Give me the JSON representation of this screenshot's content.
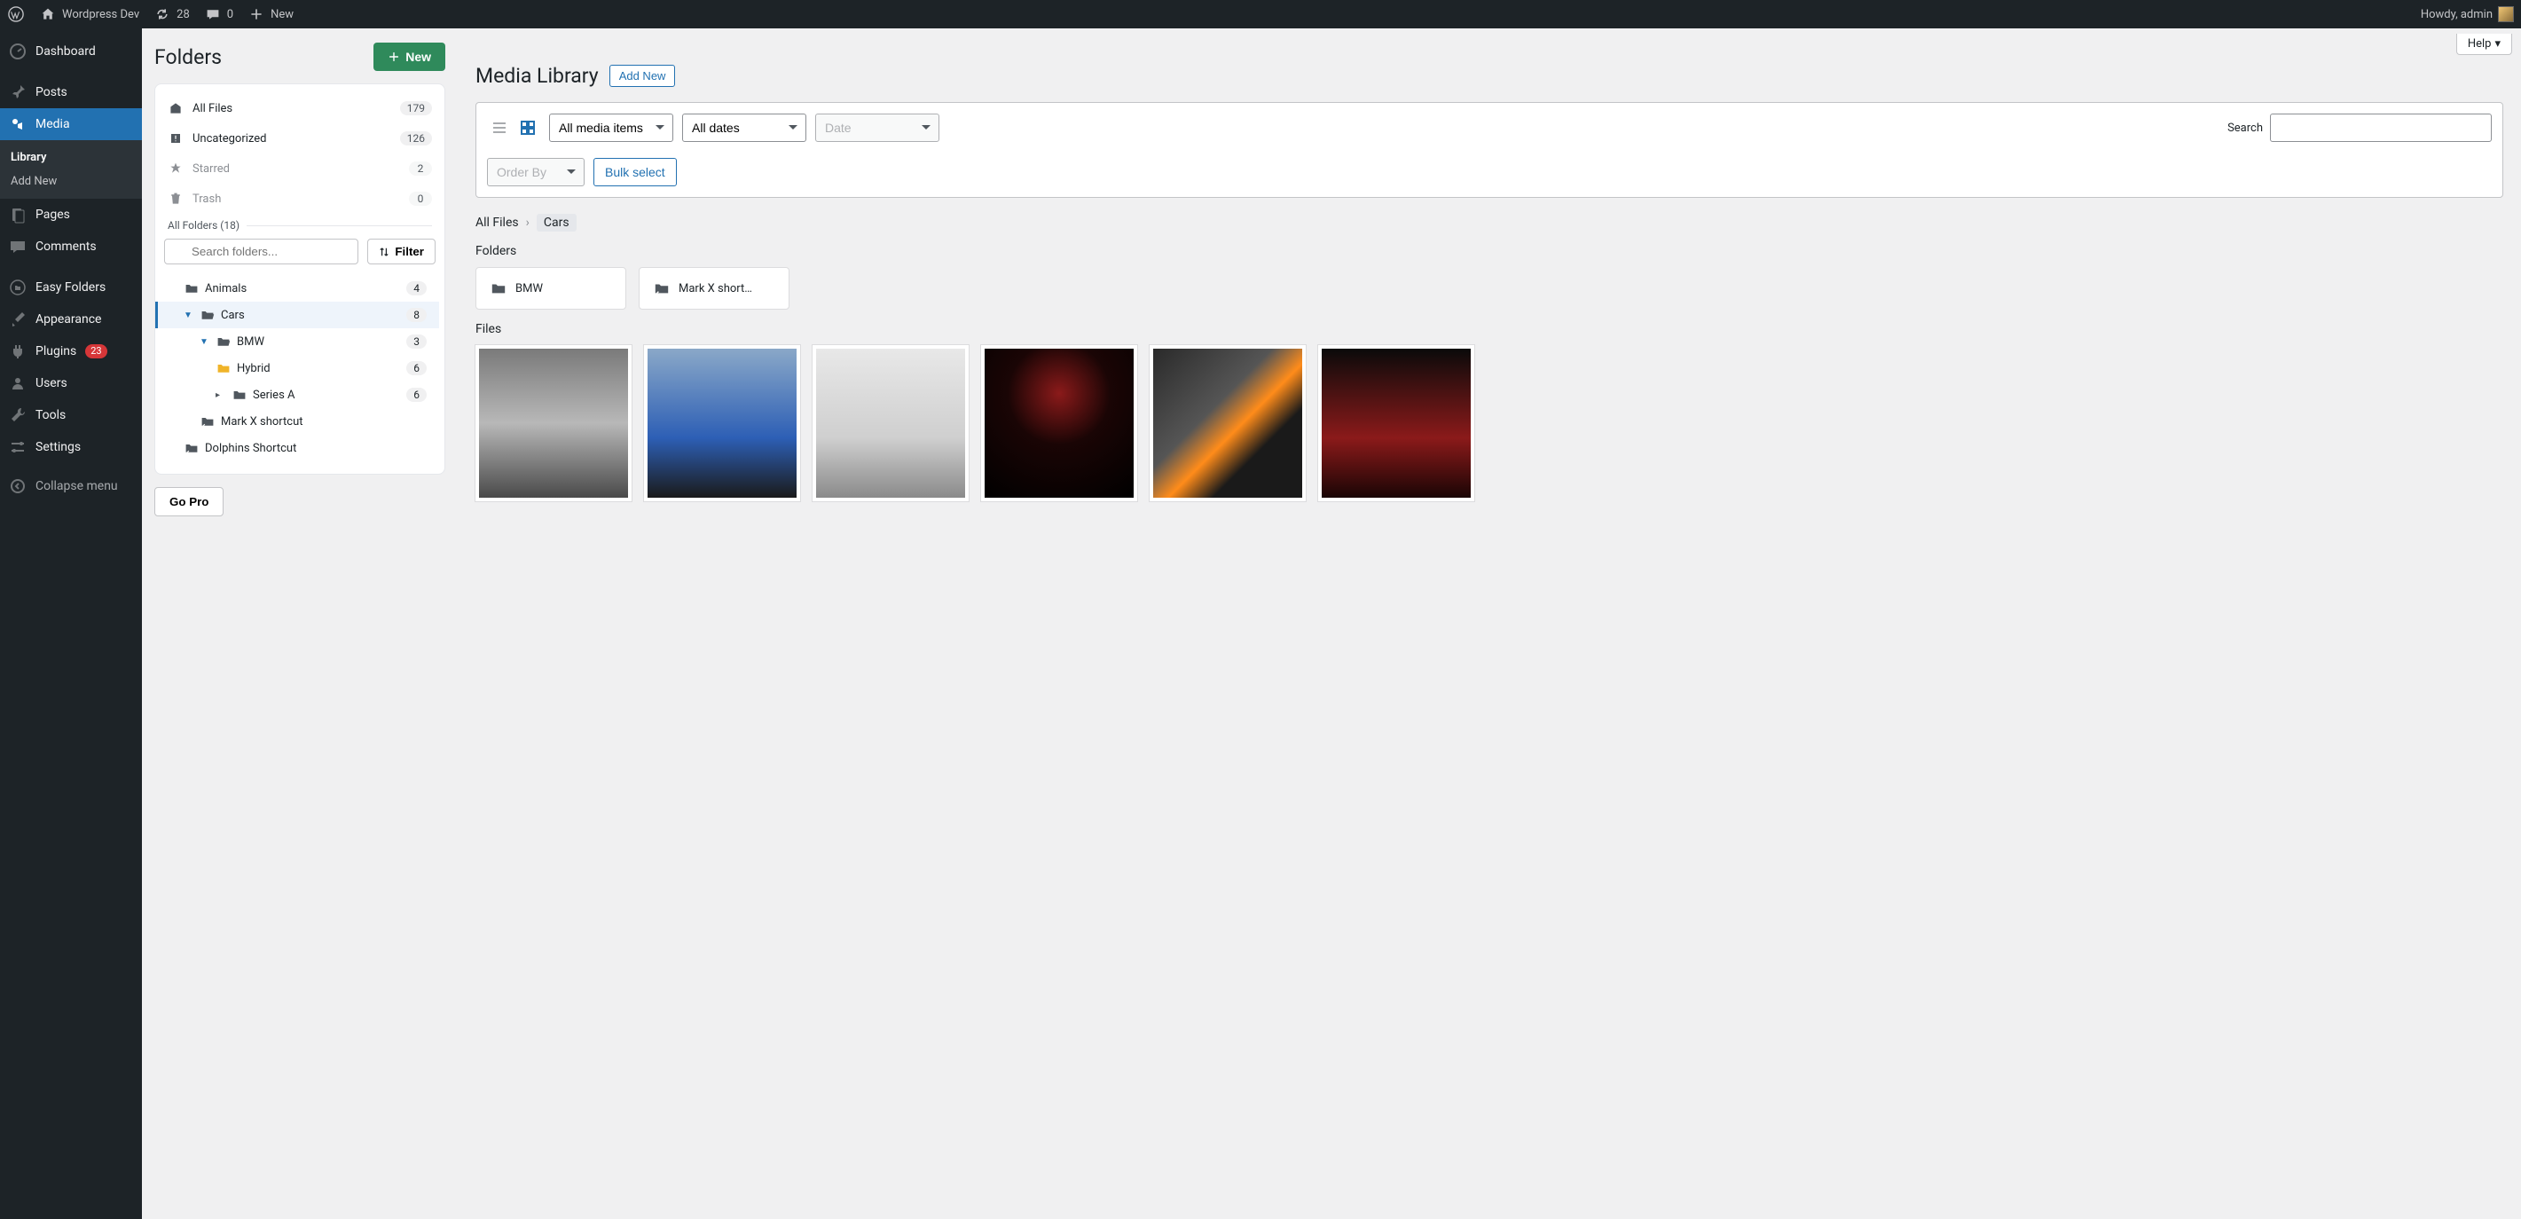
{
  "adminBar": {
    "siteName": "Wordpress Dev",
    "updates": "28",
    "comments": "0",
    "newLabel": "New",
    "greeting": "Howdy, admin"
  },
  "adminMenu": {
    "dashboard": "Dashboard",
    "posts": "Posts",
    "media": "Media",
    "mediaSub": {
      "library": "Library",
      "addNew": "Add New"
    },
    "pages": "Pages",
    "commentsItem": "Comments",
    "easyFolders": "Easy Folders",
    "appearance": "Appearance",
    "plugins": "Plugins",
    "pluginsCount": "23",
    "users": "Users",
    "tools": "Tools",
    "settings": "Settings",
    "collapse": "Collapse menu"
  },
  "foldersPanel": {
    "title": "Folders",
    "newBtn": "New",
    "allFiles": {
      "label": "All Files",
      "count": "179"
    },
    "uncategorized": {
      "label": "Uncategorized",
      "count": "126"
    },
    "starred": {
      "label": "Starred",
      "count": "2"
    },
    "trash": {
      "label": "Trash",
      "count": "0"
    },
    "sectionLabel": "All Folders (18)",
    "searchPlaceholder": "Search folders...",
    "filterBtn": "Filter",
    "tree": {
      "animals": {
        "label": "Animals",
        "count": "4"
      },
      "cars": {
        "label": "Cars",
        "count": "8"
      },
      "bmw": {
        "label": "BMW",
        "count": "3"
      },
      "hybrid": {
        "label": "Hybrid",
        "count": "6"
      },
      "seriesA": {
        "label": "Series A",
        "count": "6"
      },
      "markX": {
        "label": "Mark X shortcut"
      },
      "dolphins": {
        "label": "Dolphins Shortcut"
      }
    },
    "goPro": "Go Pro"
  },
  "main": {
    "help": "Help",
    "title": "Media Library",
    "addNew": "Add New",
    "filters": {
      "mediaItems": "All media items",
      "allDates": "All dates",
      "date": "Date",
      "orderBy": "Order By",
      "bulkSelect": "Bulk select",
      "searchLabel": "Search"
    },
    "breadcrumb": {
      "root": "All Files",
      "current": "Cars"
    },
    "foldersLabel": "Folders",
    "folderCards": {
      "bmw": "BMW",
      "markX": "Mark X short…"
    },
    "filesLabel": "Files"
  }
}
